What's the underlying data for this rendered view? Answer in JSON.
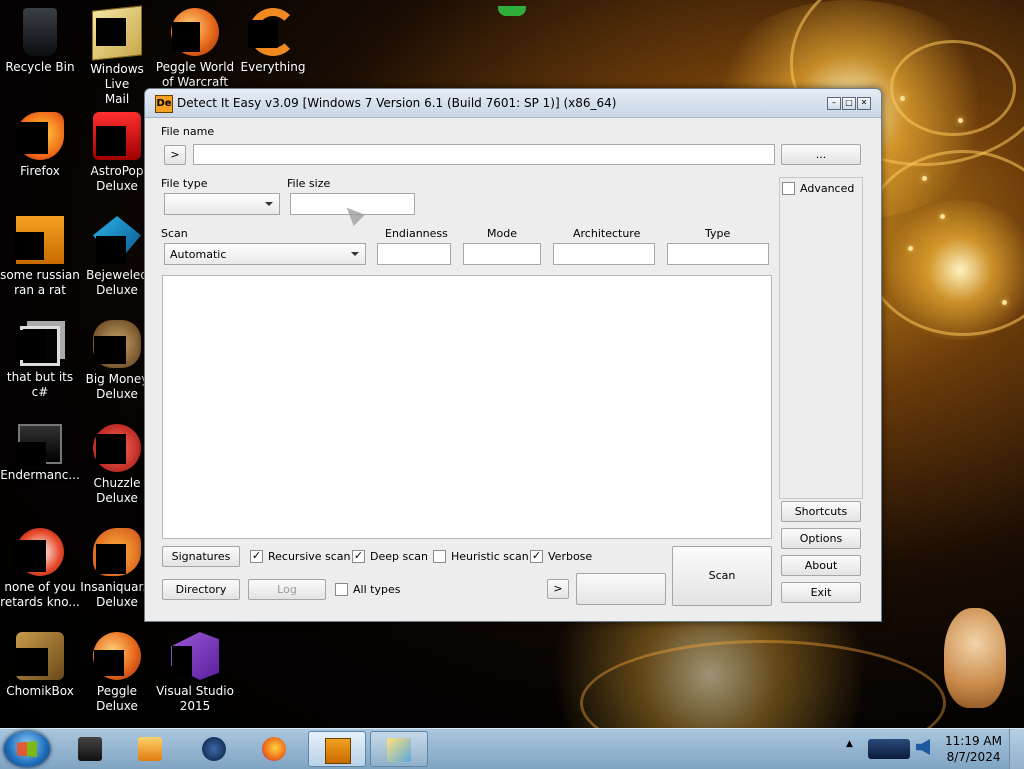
{
  "desktop": {
    "icons": [
      {
        "label": "Recycle Bin"
      },
      {
        "label": "Windows Live\nMail"
      },
      {
        "label": "Peggle World\nof Warcraft ..."
      },
      {
        "label": "Everything"
      },
      {
        "label": "Firefox"
      },
      {
        "label": "AstroPop\nDeluxe"
      },
      {
        "label": "some russian\nran a rat"
      },
      {
        "label": "Bejeweled\nDeluxe"
      },
      {
        "label": "that but its c#"
      },
      {
        "label": "Big Money\nDeluxe"
      },
      {
        "label": "Endermanc..."
      },
      {
        "label": "Chuzzle\nDeluxe"
      },
      {
        "label": "none of you\nretards kno..."
      },
      {
        "label": "Insaniquar...\nDeluxe"
      },
      {
        "label": "ChomikBox"
      },
      {
        "label": "Peggle Deluxe"
      },
      {
        "label": "Visual Studio\n2015"
      }
    ]
  },
  "window": {
    "icon_text": "De",
    "title": "Detect It Easy v3.09 [Windows 7 Version 6.1 (Build 7601: SP 1)] (x86_64)",
    "file_name_label": "File name",
    "file_name_value": "",
    "arrow_btn": ">",
    "browse_btn": "...",
    "file_type_label": "File type",
    "file_size_label": "File size",
    "scan_label": "Scan",
    "scan_value": "Automatic",
    "endianness_label": "Endianness",
    "mode_label": "Mode",
    "architecture_label": "Architecture",
    "type_label": "Type",
    "advanced_label": "Advanced",
    "signatures_btn": "Signatures",
    "directory_btn": "Directory",
    "log_btn": "Log",
    "recursive_scan": {
      "label": "Recursive scan",
      "checked": true
    },
    "deep_scan": {
      "label": "Deep scan",
      "checked": true
    },
    "heuristic_scan": {
      "label": "Heuristic scan",
      "checked": false
    },
    "verbose": {
      "label": "Verbose",
      "checked": true
    },
    "all_types": {
      "label": "All types",
      "checked": false
    },
    "next_btn": ">",
    "scan_btn": "Scan",
    "shortcuts_btn": "Shortcuts",
    "options_btn": "Options",
    "about_btn": "About",
    "exit_btn": "Exit"
  },
  "taskbar": {
    "time": "11:19 AM",
    "date": "8/7/2024",
    "tray_arrow": "▲"
  },
  "colors": {
    "accent_orange": "#f4a020",
    "taskbar": "#a9c6de"
  }
}
